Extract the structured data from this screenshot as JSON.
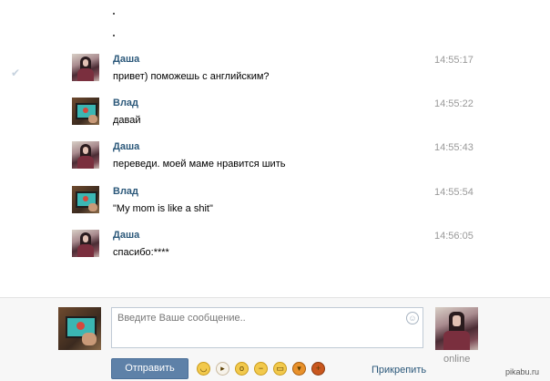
{
  "messages": [
    {
      "sender": "Даша",
      "text": "привет) поможешь с английским?",
      "time": "14:55:17",
      "avatar": "dasha"
    },
    {
      "sender": "Влад",
      "text": "давай",
      "time": "14:55:22",
      "avatar": "vlad"
    },
    {
      "sender": "Даша",
      "text": "переведи. моей маме нравится шить",
      "time": "14:55:43",
      "avatar": "dasha"
    },
    {
      "sender": "Влад",
      "text": "\"My mom is like a shit\"",
      "time": "14:55:54",
      "avatar": "vlad"
    },
    {
      "sender": "Даша",
      "text": "спасибо:****",
      "time": "14:56:05",
      "avatar": "dasha"
    }
  ],
  "composer": {
    "placeholder": "Введите Ваше сообщение..",
    "send_label": "Отправить",
    "attach_label": "Прикрепить",
    "online_label": "online"
  },
  "emoji_icons": [
    "blush-emoji-icon",
    "chicken-emoji-icon",
    "surprised-emoji-icon",
    "unamused-emoji-icon",
    "grin-emoji-icon",
    "pumpkin-emoji-icon",
    "basketball-emoji-icon"
  ],
  "icons": {
    "read_check": "check-icon",
    "smile": "smile-icon"
  },
  "colors": {
    "name": "#2b587a",
    "time": "#999999",
    "send_button": "#5e81a8"
  },
  "watermark": "pikabu.ru"
}
